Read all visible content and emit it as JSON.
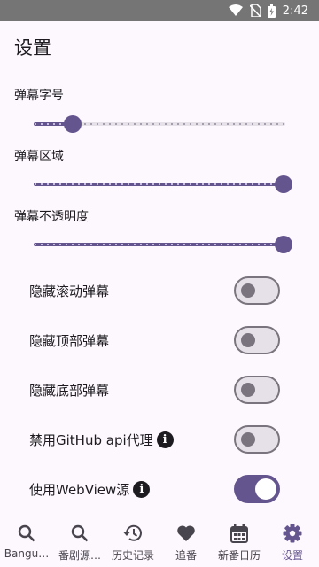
{
  "status_bar": {
    "time": "2:42"
  },
  "page": {
    "title": "设置"
  },
  "sliders": [
    {
      "label": "弹幕字号",
      "value_fraction": 0.15
    },
    {
      "label": "弹幕区域",
      "value_fraction": 1.0
    },
    {
      "label": "弹幕不透明度",
      "value_fraction": 1.0
    }
  ],
  "toggles": [
    {
      "label": "隐藏滚动弹幕",
      "checked": false
    },
    {
      "label": "隐藏顶部弹幕",
      "checked": false
    },
    {
      "label": "隐藏底部弹幕",
      "checked": false
    },
    {
      "label": "禁用GitHub api代理",
      "checked": false,
      "info_icon": true
    },
    {
      "label": "使用WebView源",
      "checked": true,
      "info_icon": true
    }
  ],
  "bottom_nav": [
    {
      "label": "Bangu…",
      "icon": "search-icon"
    },
    {
      "label": "番剧源…",
      "icon": "search-icon"
    },
    {
      "label": "历史记录",
      "icon": "history-icon"
    },
    {
      "label": "追番",
      "icon": "heart-icon"
    },
    {
      "label": "新番日历",
      "icon": "calendar-icon"
    },
    {
      "label": "设置",
      "icon": "gear-icon",
      "active": true
    }
  ],
  "colors": {
    "accent": "#65558f",
    "track_inactive": "#e6e0e9",
    "background": "#fdf8fd"
  }
}
